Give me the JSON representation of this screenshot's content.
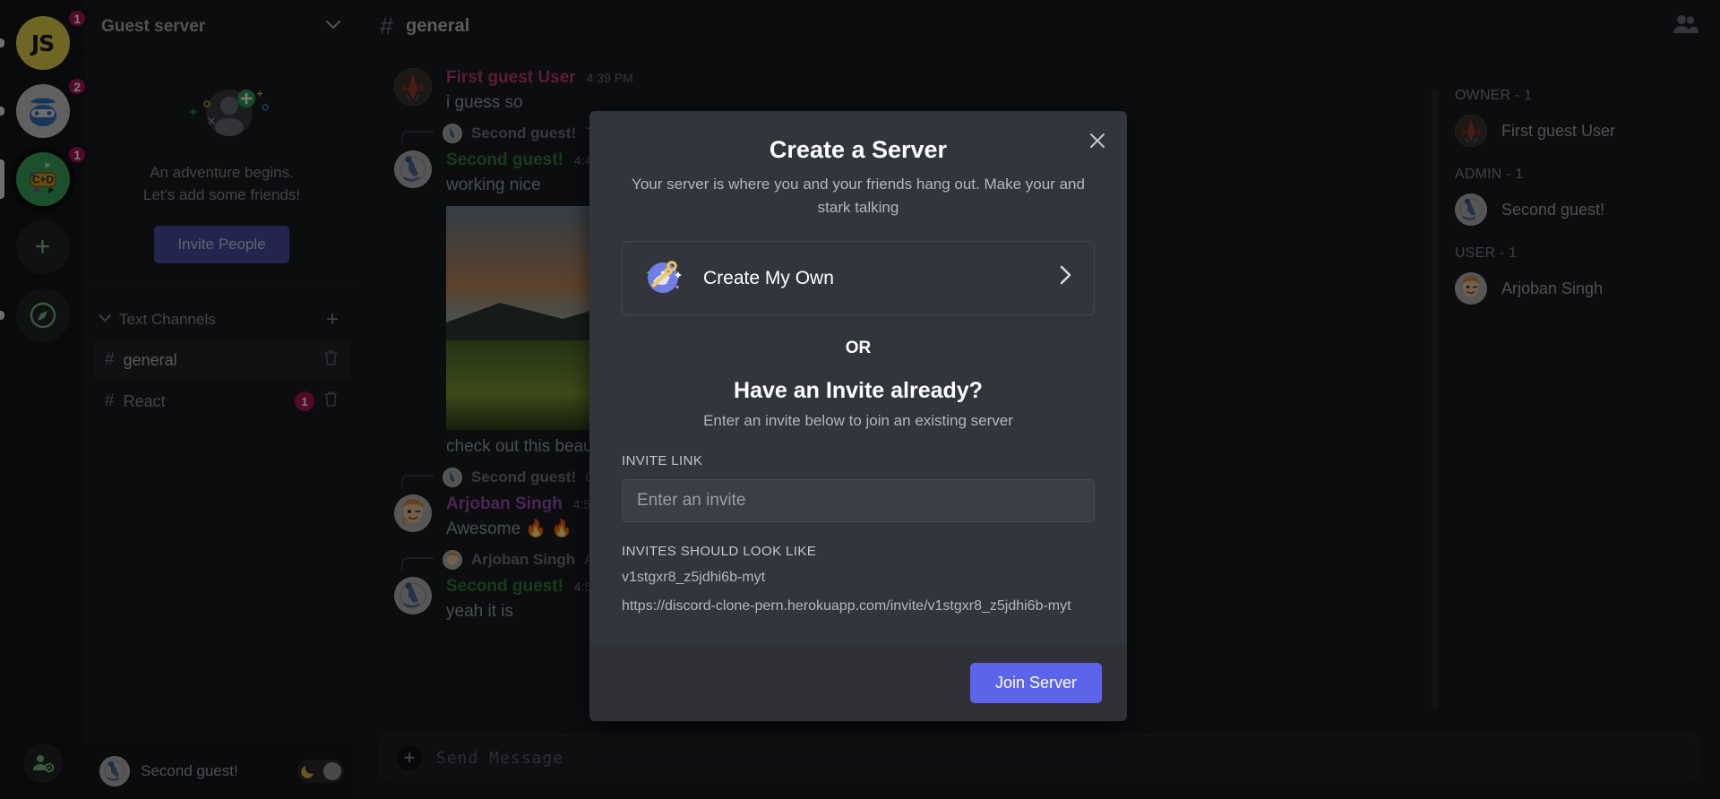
{
  "server_rail": {
    "servers": [
      {
        "name": "JS",
        "icon": "js-server-icon",
        "badge": "1",
        "color": "#e8d44d",
        "active": false
      },
      {
        "name": "Gamer",
        "icon": "gamer-server-icon",
        "badge": "2",
        "color": "#c9c9c9",
        "active": false
      },
      {
        "name": "C+D",
        "icon": "cd-server-icon",
        "badge": "1",
        "color": "#3ba55d",
        "active": true
      }
    ],
    "add_server_label": "+",
    "explore_label": "compass-icon",
    "settings_label": "user-settings-icon"
  },
  "sidebar": {
    "server_name": "Guest server",
    "dropdown_icon": "chevron-down-icon",
    "adventure_line1": "An adventure begins.",
    "adventure_line2": "Let's add some friends!",
    "invite_people_label": "Invite People",
    "channels_header": "Text Channels",
    "add_channel_label": "+",
    "channels": [
      {
        "name": "general",
        "hash": "#",
        "badge": "",
        "active": true
      },
      {
        "name": "React",
        "hash": "#",
        "badge": "1",
        "active": false
      }
    ],
    "current_user": "Second guest!",
    "theme_toggle": "dark-mode-toggle"
  },
  "header": {
    "hash": "#",
    "channel_name": "general",
    "members_icon": "members-icon"
  },
  "messages": [
    {
      "type": "message",
      "author": "First guest User",
      "author_color": "#c03a7e",
      "time": "4:39 PM",
      "text": "i guess so",
      "avatar": "crab-avatar"
    },
    {
      "type": "reply",
      "author": "Second guest!",
      "snippet": "Te",
      "avatar": "snowboarder-avatar"
    },
    {
      "type": "message",
      "author": "Second guest!",
      "author_color": "#2e7d32",
      "time": "4:4",
      "text": "working nice",
      "avatar": "snowboarder-avatar",
      "image": "landscape-photo"
    },
    {
      "type": "caption",
      "text": "check out this beau"
    },
    {
      "type": "reply",
      "author": "Second guest!",
      "snippet": "Ch",
      "avatar": "snowboarder-avatar"
    },
    {
      "type": "message",
      "author": "Arjoban Singh",
      "author_color": "#9b4fb5",
      "time": "4:5",
      "text": "Awesome 🔥 🔥",
      "avatar": "face-avatar"
    },
    {
      "type": "reply",
      "author": "Arjoban Singh",
      "snippet": "Aw",
      "avatar": "face-avatar"
    },
    {
      "type": "message",
      "author": "Second guest!",
      "author_color": "#2e7d32",
      "time": "4:5",
      "text": "yeah it is",
      "avatar": "snowboarder-avatar"
    }
  ],
  "members_panel": {
    "groups": [
      {
        "label": "OWNER - 1",
        "members": [
          {
            "name": "First guest User",
            "avatar": "crab-avatar"
          }
        ]
      },
      {
        "label": "ADMIN - 1",
        "members": [
          {
            "name": "Second guest!",
            "avatar": "snowboarder-avatar"
          }
        ]
      },
      {
        "label": "USER - 1",
        "members": [
          {
            "name": "Arjoban Singh",
            "avatar": "face-avatar"
          }
        ]
      }
    ]
  },
  "message_input": {
    "plus_label": "+",
    "placeholder": "Send Message",
    "value": ""
  },
  "modal": {
    "title": "Create a Server",
    "subtitle": "Your server is where you and your friends hang out. Make your and stark talking",
    "close_icon": "close-icon",
    "create_own_label": "Create My Own",
    "create_own_icon": "globe-key-icon",
    "arrow_icon": "chevron-right-icon",
    "or_label": "OR",
    "invite_heading": "Have an Invite already?",
    "invite_subheading": "Enter an invite below to join an existing server",
    "invite_link_label": "INVITE LINK",
    "invite_placeholder": "Enter an invite",
    "invite_value": "",
    "examples_label": "INVITES SHOULD LOOK LIKE",
    "example_code": "v1stgxr8_z5jdhi6b-myt",
    "example_url": "https://discord-clone-pern.herokuapp.com/invite/v1stgxr8_z5jdhi6b-myt",
    "join_button_label": "Join Server",
    "accent_color": "#5b64ea"
  }
}
